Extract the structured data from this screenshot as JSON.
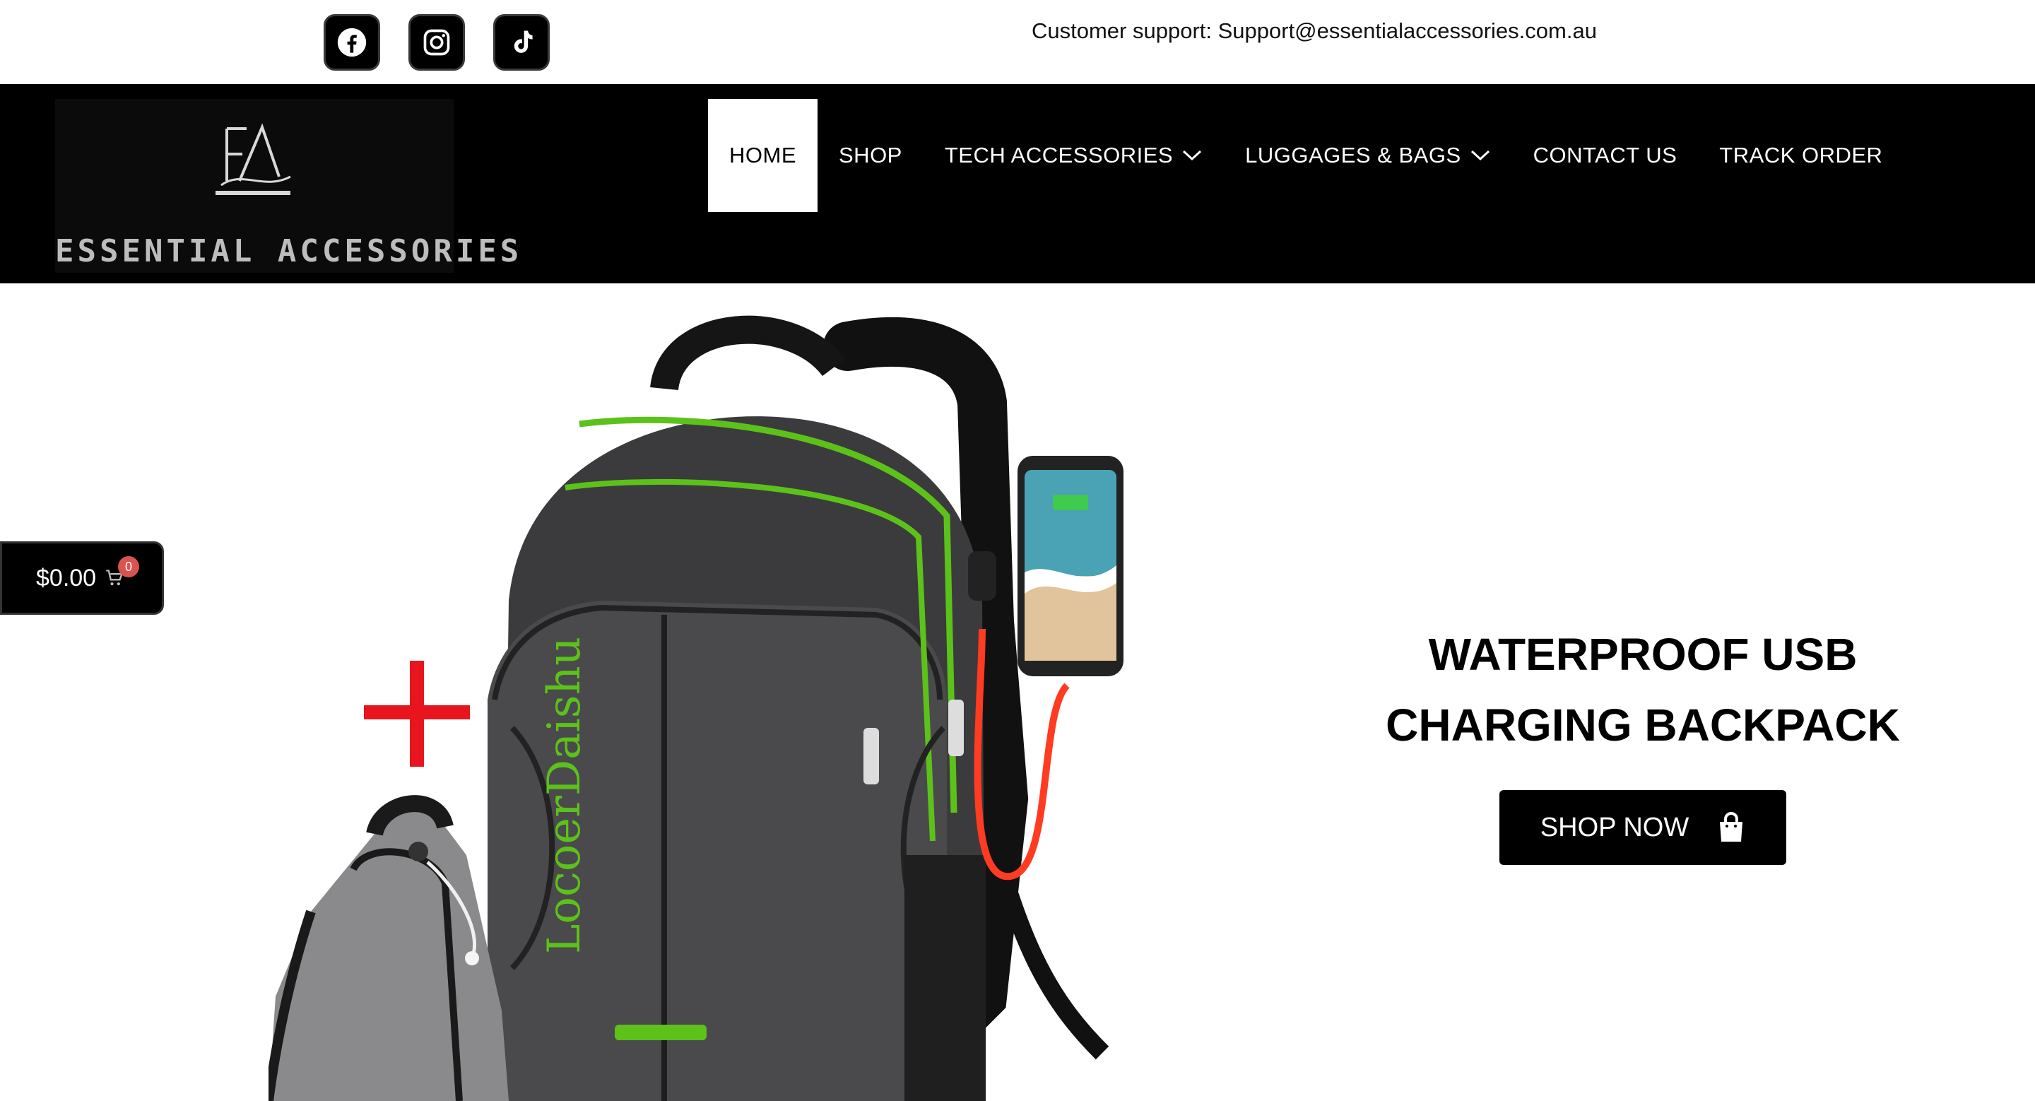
{
  "topbar": {
    "social": [
      {
        "icon": "facebook-icon"
      },
      {
        "icon": "instagram-icon"
      },
      {
        "icon": "tiktok-icon"
      }
    ],
    "support_text": "Customer support: Support@essentialaccessories.com.au"
  },
  "header": {
    "logo_initials": "EA",
    "logo_text": "ESSENTIAL ACCESSORIES",
    "nav": [
      {
        "label": "HOME",
        "active": true
      },
      {
        "label": "SHOP"
      },
      {
        "label": "TECH ACCESSORIES",
        "dropdown": true
      },
      {
        "label": "LUGGAGES & BAGS",
        "dropdown": true
      },
      {
        "label": "CONTACT US"
      },
      {
        "label": "TRACK ORDER"
      }
    ]
  },
  "cart": {
    "amount": "$0.00",
    "count": "0"
  },
  "hero": {
    "product_brand_text": "LocoerDaishu",
    "title_line1": "WATERPROOF USB",
    "title_line2": "CHARGING BACKPACK",
    "button_label": "SHOP NOW"
  },
  "colors": {
    "accent_green": "#5cc21a",
    "header_bg": "#000000",
    "badge_red": "#d9534f"
  }
}
